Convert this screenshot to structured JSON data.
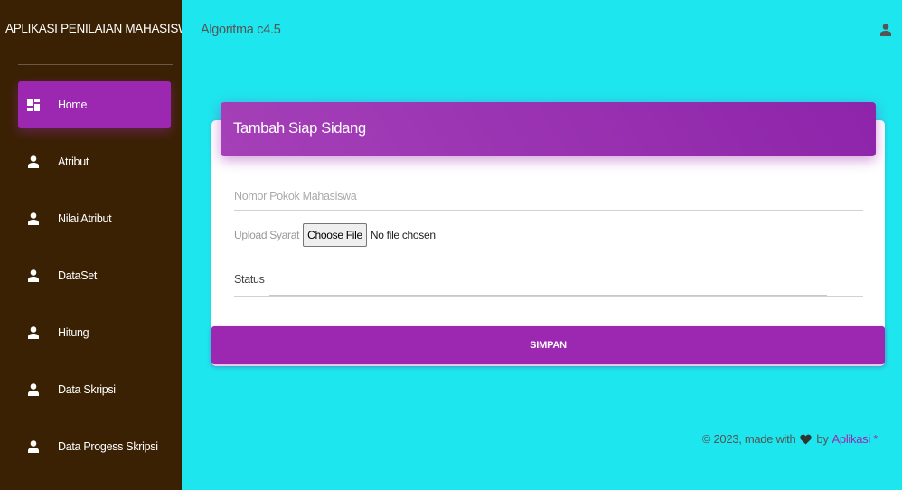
{
  "sidebar": {
    "brand": "APLIKASI PENILAIAN MAHASISWA SIAP SIDANG",
    "items": [
      {
        "label": "Home",
        "icon": "dashboard-icon",
        "active": true
      },
      {
        "label": "Atribut",
        "icon": "person-icon"
      },
      {
        "label": "Nilai Atribut",
        "icon": "person-icon"
      },
      {
        "label": "DataSet",
        "icon": "person-icon"
      },
      {
        "label": "Hitung",
        "icon": "person-icon"
      },
      {
        "label": "Data Skripsi",
        "icon": "person-icon"
      },
      {
        "label": "Data Progess Skripsi",
        "icon": "person-icon"
      }
    ]
  },
  "topbar": {
    "title": "Algoritma c4.5",
    "user_icon": "person-icon"
  },
  "form": {
    "title": "Tambah Siap Sidang",
    "npm_placeholder": "Nomor Pokok Mahasiswa",
    "upload_label": "Upload Syarat",
    "choose_file_label": "Choose File",
    "no_file_text": "No file chosen",
    "status_label": "Status",
    "submit_label": "SIMPAN"
  },
  "footer": {
    "prefix": "© 2023, made with",
    "by": "by",
    "link": "Aplikasi *",
    "heart_icon": "heart-icon"
  },
  "colors": {
    "accent": "#9c27b0",
    "background": "#1de6ee",
    "sidebar": "#3b2104"
  }
}
